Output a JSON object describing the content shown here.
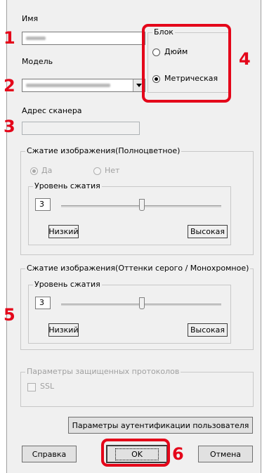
{
  "name_label": "Имя",
  "model_label": "Модель",
  "scanner_address_label": "Адрес сканера",
  "unit": {
    "legend": "Блок",
    "options": [
      "Дюйм",
      "Метрическая"
    ],
    "selected": "Метрическая"
  },
  "color_compression": {
    "legend": "Сжатие изображения(Полноцветное)",
    "yes_label": "Да",
    "no_label": "Нет",
    "level_legend": "Уровень сжатия",
    "level_value": "3",
    "low_label": "Низкий",
    "high_label": "Высокая"
  },
  "gray_compression": {
    "legend": "Сжатие изображения(Оттенки серого / Монохромное)",
    "level_legend": "Уровень сжатия",
    "level_value": "3",
    "low_label": "Низкий",
    "high_label": "Высокая"
  },
  "secure": {
    "legend": "Параметры защищенных протоколов",
    "ssl_label": "SSL"
  },
  "buttons": {
    "auth": "Параметры аутентификации пользователя",
    "help": "Справка",
    "ok": "OK",
    "cancel": "Отмена"
  },
  "callouts": [
    "1",
    "2",
    "3",
    "4",
    "5",
    "6"
  ],
  "colors": {
    "callout": "#e4061a",
    "dialog_bg": "#f0f0f0"
  }
}
